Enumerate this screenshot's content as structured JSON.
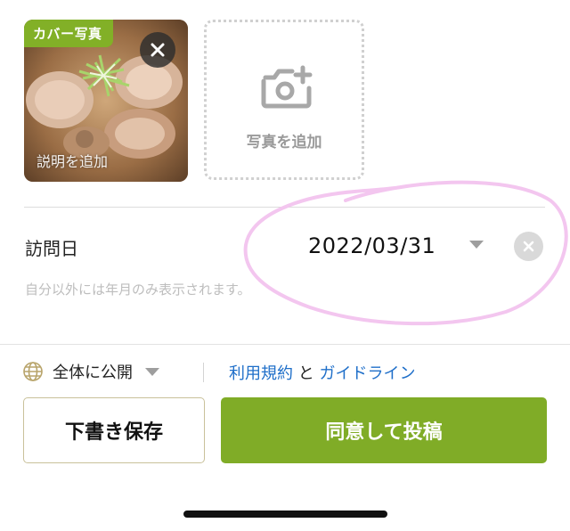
{
  "photos": {
    "cover_badge": "カバー写真",
    "caption_placeholder": "説明を追加",
    "add_photo_label": "写真を追加"
  },
  "visit": {
    "label": "訪問日",
    "date": "2022/03/31",
    "note": "自分以外には年月のみ表示されます。"
  },
  "footer": {
    "visibility": "全体に公開",
    "terms_link": "利用規約",
    "conjunction": " と ",
    "guideline_link": "ガイドライン",
    "draft_label": "下書き保存",
    "post_label": "同意して投稿"
  },
  "colors": {
    "accent_green": "#80ac27",
    "link_blue": "#1f6fc9",
    "highlight_pink": "#f3c6ef"
  },
  "icons": [
    "close-icon",
    "camera-plus-icon",
    "chevron-down-icon",
    "clear-icon",
    "globe-icon"
  ]
}
